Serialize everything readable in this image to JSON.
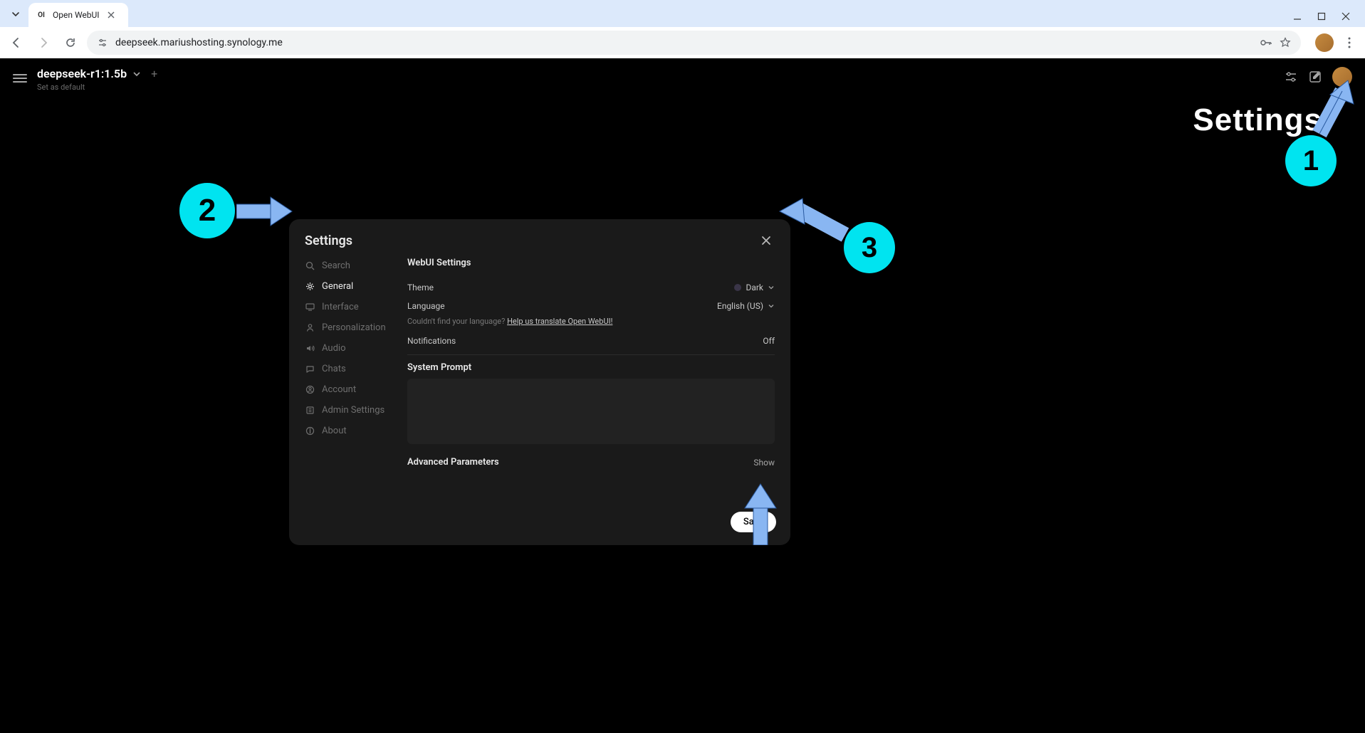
{
  "browser": {
    "tab_title": "Open WebUI",
    "url": "deepseek.mariushosting.synology.me"
  },
  "app": {
    "model_name": "deepseek-r1:1.5b",
    "set_default": "Set as default"
  },
  "modal": {
    "title": "Settings",
    "nav": {
      "search": "Search",
      "general": "General",
      "interface": "Interface",
      "personalization": "Personalization",
      "audio": "Audio",
      "chats": "Chats",
      "account": "Account",
      "admin": "Admin Settings",
      "about": "About"
    },
    "section_title": "WebUI Settings",
    "theme": {
      "label": "Theme",
      "value": "Dark"
    },
    "language": {
      "label": "Language",
      "value": "English (US)",
      "hint_prefix": "Couldn't find your language? ",
      "hint_link": "Help us translate Open WebUI!"
    },
    "notifications": {
      "label": "Notifications",
      "value": "Off"
    },
    "system_prompt_label": "System Prompt",
    "advanced": {
      "label": "Advanced Parameters",
      "show": "Show"
    },
    "save": "Save"
  },
  "annotations": {
    "settings_label": "Settings",
    "b1": "1",
    "b2": "2",
    "b3": "3"
  }
}
